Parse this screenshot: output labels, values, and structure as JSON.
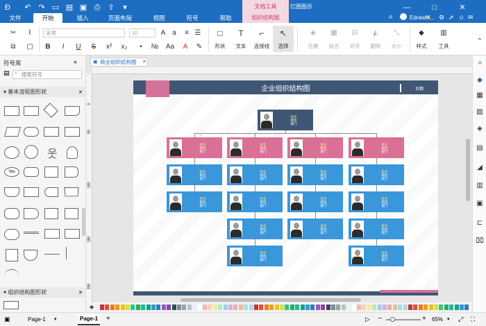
{
  "titlebar": {
    "contextual_group": "文档工具",
    "contextual_tab": "组织结构图",
    "window_title": "亿图图示",
    "user_name": "EdrawM...",
    "tabs": [
      "文件",
      "开始",
      "插入",
      "页面布局",
      "视图",
      "符号",
      "帮助"
    ]
  },
  "ribbon": {
    "font_name": "宋体",
    "font_size": "10",
    "tools": [
      {
        "label": "形状"
      },
      {
        "label": "文本"
      },
      {
        "label": "连接线"
      },
      {
        "label": "选择"
      },
      {
        "label": "位置"
      },
      {
        "label": "组合"
      },
      {
        "label": "对齐"
      },
      {
        "label": "翻转"
      },
      {
        "label": "大小"
      },
      {
        "label": "样式"
      },
      {
        "label": "工具"
      }
    ]
  },
  "left_panel": {
    "title": "符号库",
    "search_placeholder": "搜索符号",
    "section1": "基本流程图形状",
    "section2": "组织结构图形状",
    "yes_shape_label": "Yes"
  },
  "document": {
    "tab_label": "商业组织结构图",
    "page_title": "企业组织结构图",
    "date_label": "日期",
    "card_fields": {
      "name": "姓名",
      "title": "职位",
      "dept": "部门"
    },
    "ruler_v": [
      "0",
      "50",
      "100",
      "150",
      "200"
    ]
  },
  "status": {
    "page_selector": "Page-1",
    "page_tab": "Page-1",
    "add_page": "+",
    "zoom": "65%",
    "minus": "−",
    "plus": "+"
  },
  "colors": {
    "titlebar": "#1d6ec2",
    "header": "#3f5775",
    "pink_card": "#da7096",
    "blue_card": "#3a97da",
    "dark_card": "#3f5775"
  }
}
